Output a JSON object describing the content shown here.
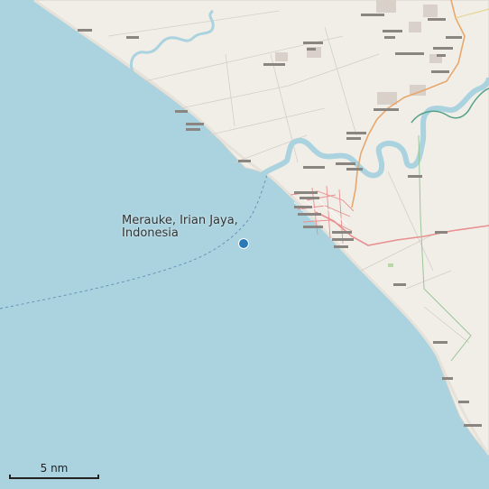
{
  "map": {
    "place_label": "Merauke, Irian Jaya,\nIndonesia",
    "scale_label": "5 nm",
    "colors": {
      "sea": "#aad3df",
      "land": "#f1eee8",
      "marker": "#2a7ab8",
      "river": "#aad3df",
      "primary_road": "#e8a86b",
      "secondary_road": "#e89090",
      "boundary": "#99c699"
    }
  }
}
